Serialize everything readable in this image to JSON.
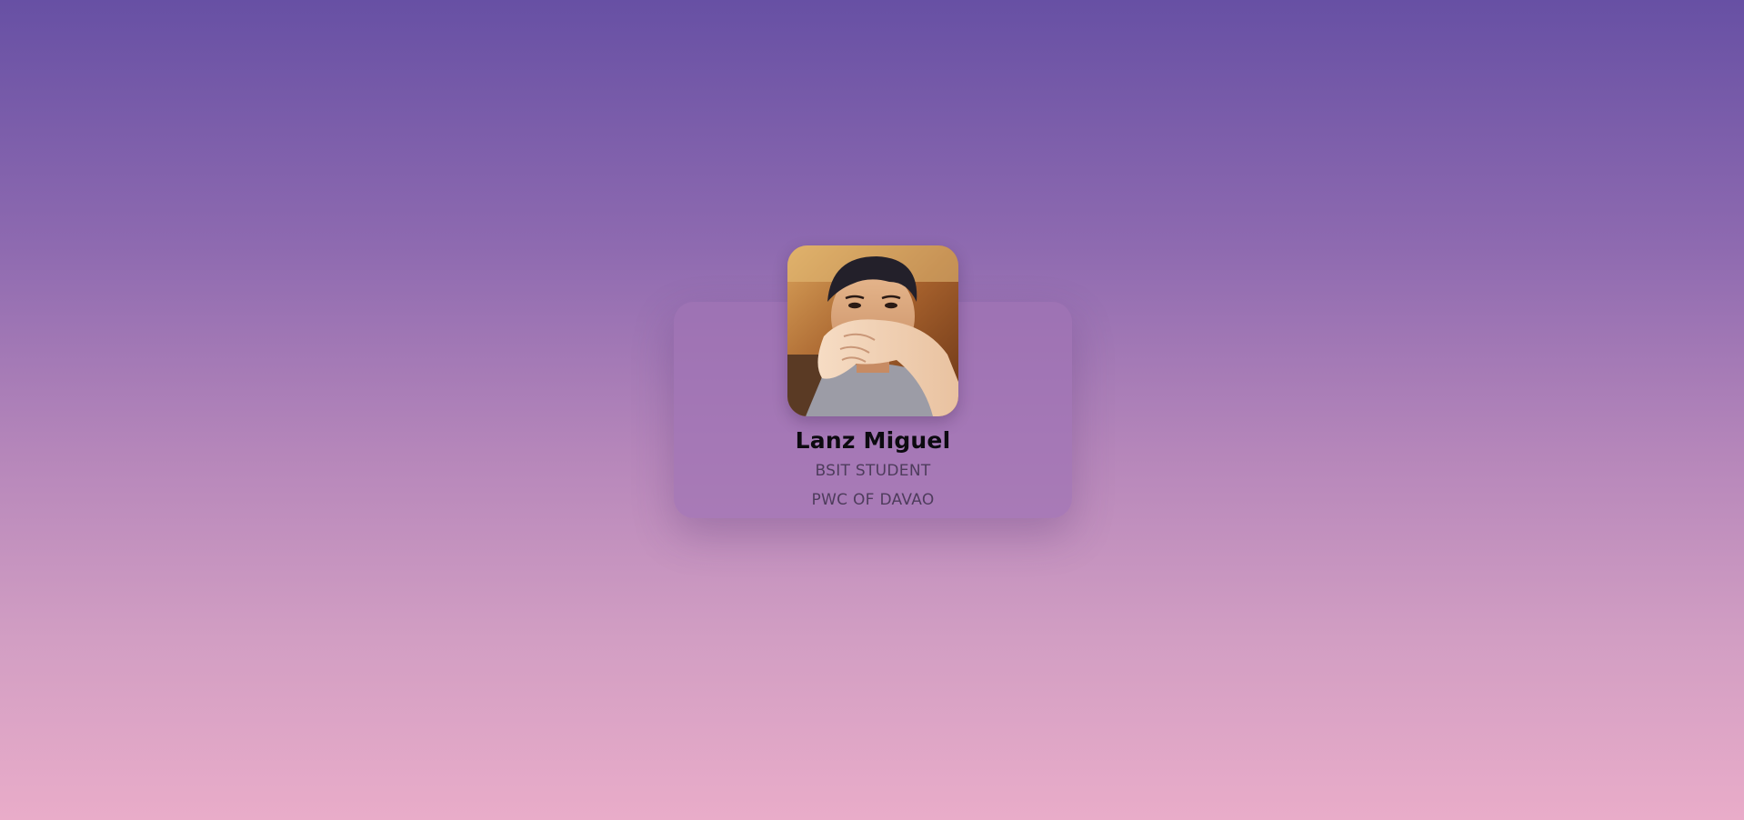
{
  "profile": {
    "name": "Lanz Miguel",
    "role": "BSIT STUDENT",
    "school": "PWC OF DAVAO",
    "photo_icon": "profile-photo"
  },
  "colors": {
    "gradient_top": "#6750a4",
    "gradient_bottom": "#e9acc9",
    "card": "#a073b4",
    "name_text": "#0c0a10",
    "secondary_text": "#4e3c5c"
  }
}
